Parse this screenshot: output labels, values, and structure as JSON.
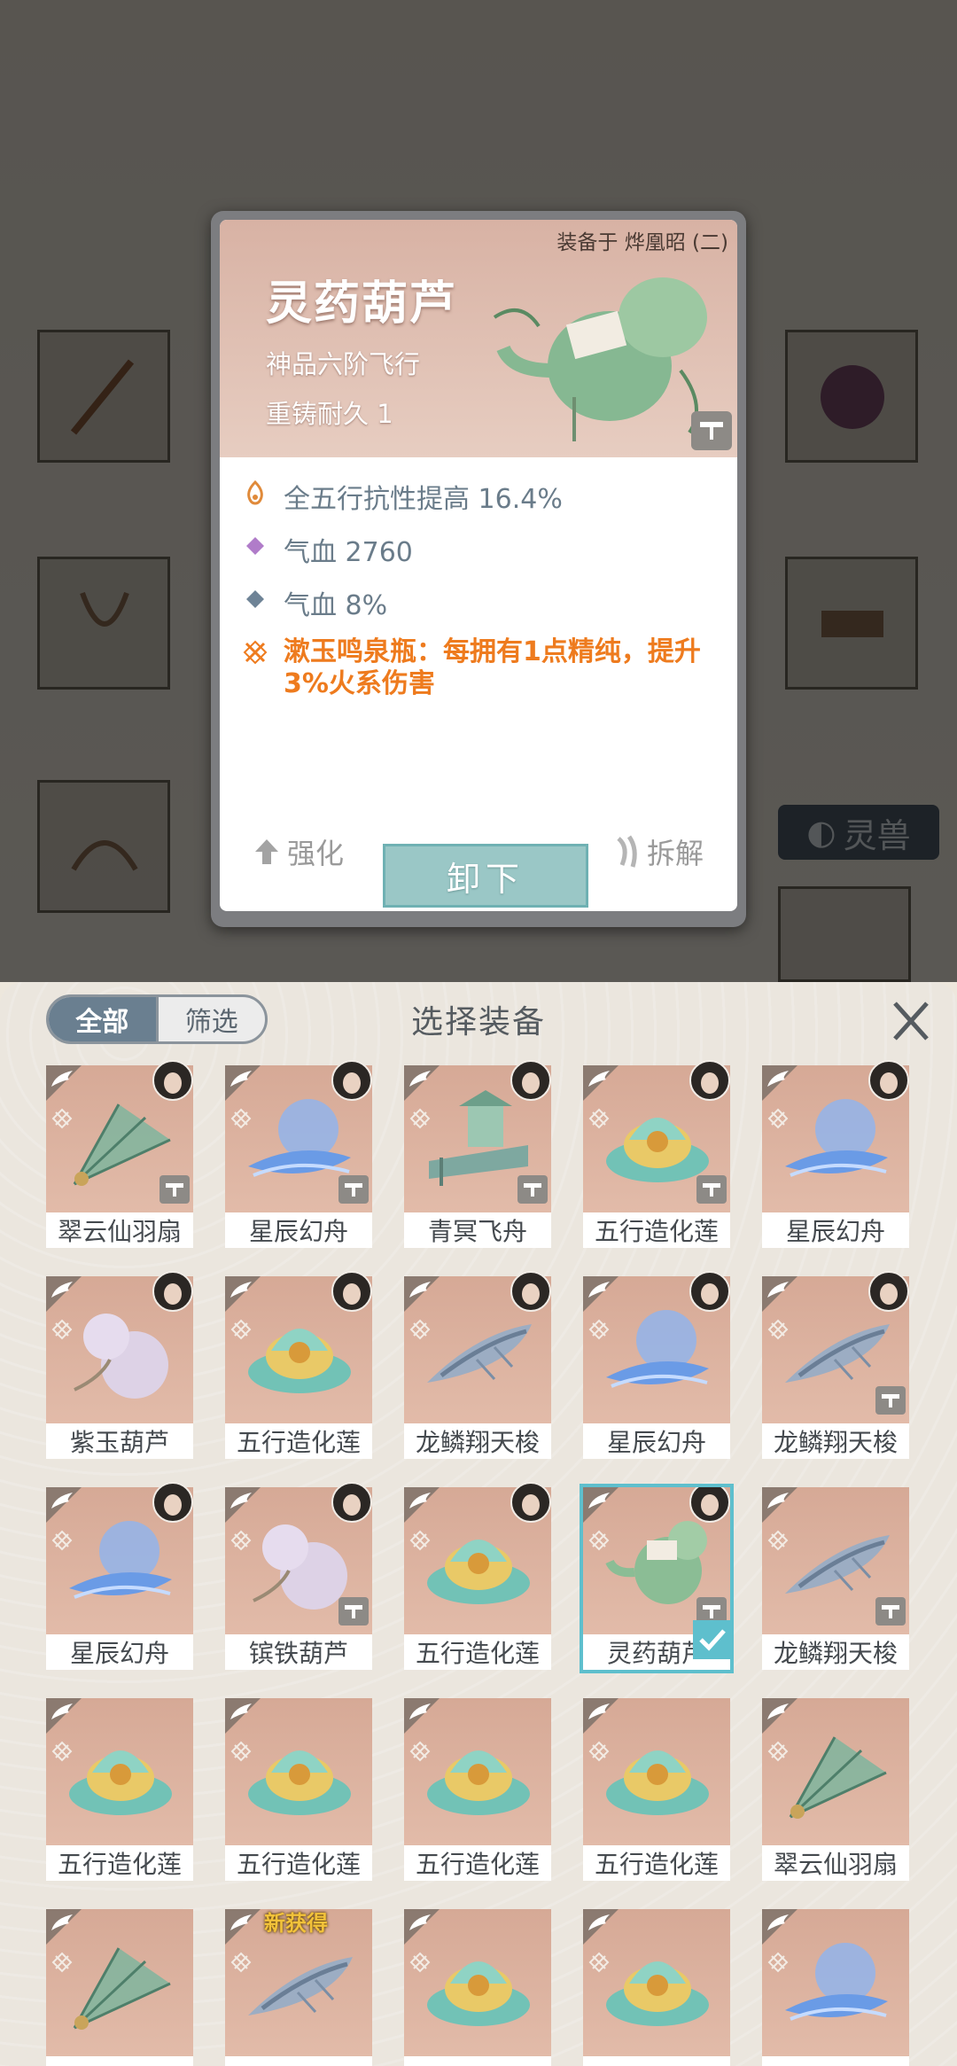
{
  "background": {
    "side_tab_label": "灵兽"
  },
  "detail": {
    "equipped_on": "装备于 烨凰昭 (二)",
    "name": "灵药葫芦",
    "grade": "神品六阶飞行",
    "durability": "重铸耐久 1",
    "stats": [
      {
        "icon": "fire-element-icon",
        "text": "全五行抗性提高 16.4%"
      },
      {
        "icon": "purple-diamond-icon",
        "text": "气血 2760"
      },
      {
        "icon": "blue-diamond-icon",
        "text": "气血 8%"
      }
    ],
    "special": "漱玉鸣泉瓶：每拥有1点精纯，提升3%火系伤害",
    "enhance_label": "强化",
    "unequip_label": "卸下",
    "dismantle_label": "拆解"
  },
  "panel": {
    "filter_all": "全部",
    "filter_screen": "筛选",
    "title": "选择装备",
    "close_icon": "close-x-icon",
    "new_label": "新获得"
  },
  "items": [
    {
      "label": "翠云仙羽扇",
      "kind": "fan",
      "avatar": true,
      "tag": true
    },
    {
      "label": "星辰幻舟",
      "kind": "boat",
      "avatar": true,
      "tag": true
    },
    {
      "label": "青冥飞舟",
      "kind": "pavilion",
      "avatar": true,
      "tag": true
    },
    {
      "label": "五行造化莲",
      "kind": "lotus",
      "avatar": true,
      "tag": true
    },
    {
      "label": "星辰幻舟",
      "kind": "boat",
      "avatar": true,
      "tag": false
    },
    {
      "label": "紫玉葫芦",
      "kind": "gourd",
      "avatar": true,
      "tag": false
    },
    {
      "label": "五行造化莲",
      "kind": "lotus",
      "avatar": true,
      "tag": false
    },
    {
      "label": "龙鳞翔天梭",
      "kind": "shuttle",
      "avatar": true,
      "tag": false
    },
    {
      "label": "星辰幻舟",
      "kind": "boat",
      "avatar": true,
      "tag": false
    },
    {
      "label": "龙鳞翔天梭",
      "kind": "shuttle",
      "avatar": true,
      "tag": true
    },
    {
      "label": "星辰幻舟",
      "kind": "boat",
      "avatar": true,
      "tag": false
    },
    {
      "label": "镔铁葫芦",
      "kind": "gourd",
      "avatar": true,
      "tag": true
    },
    {
      "label": "五行造化莲",
      "kind": "lotus",
      "avatar": true,
      "tag": false
    },
    {
      "label": "灵药葫芦",
      "kind": "gourd-green",
      "avatar": true,
      "tag": true,
      "selected": true
    },
    {
      "label": "龙鳞翔天梭",
      "kind": "shuttle",
      "avatar": false,
      "tag": true
    },
    {
      "label": "五行造化莲",
      "kind": "lotus",
      "avatar": false,
      "tag": false
    },
    {
      "label": "五行造化莲",
      "kind": "lotus",
      "avatar": false,
      "tag": false
    },
    {
      "label": "五行造化莲",
      "kind": "lotus",
      "avatar": false,
      "tag": false
    },
    {
      "label": "五行造化莲",
      "kind": "lotus",
      "avatar": false,
      "tag": false
    },
    {
      "label": "翠云仙羽扇",
      "kind": "fan",
      "avatar": false,
      "tag": false
    },
    {
      "label": "",
      "kind": "fan",
      "avatar": false,
      "tag": false
    },
    {
      "label": "",
      "kind": "shuttle",
      "avatar": false,
      "tag": false,
      "new": true
    },
    {
      "label": "",
      "kind": "lotus",
      "avatar": false,
      "tag": false
    },
    {
      "label": "",
      "kind": "lotus",
      "avatar": false,
      "tag": false
    },
    {
      "label": "",
      "kind": "boat",
      "avatar": false,
      "tag": false
    }
  ]
}
